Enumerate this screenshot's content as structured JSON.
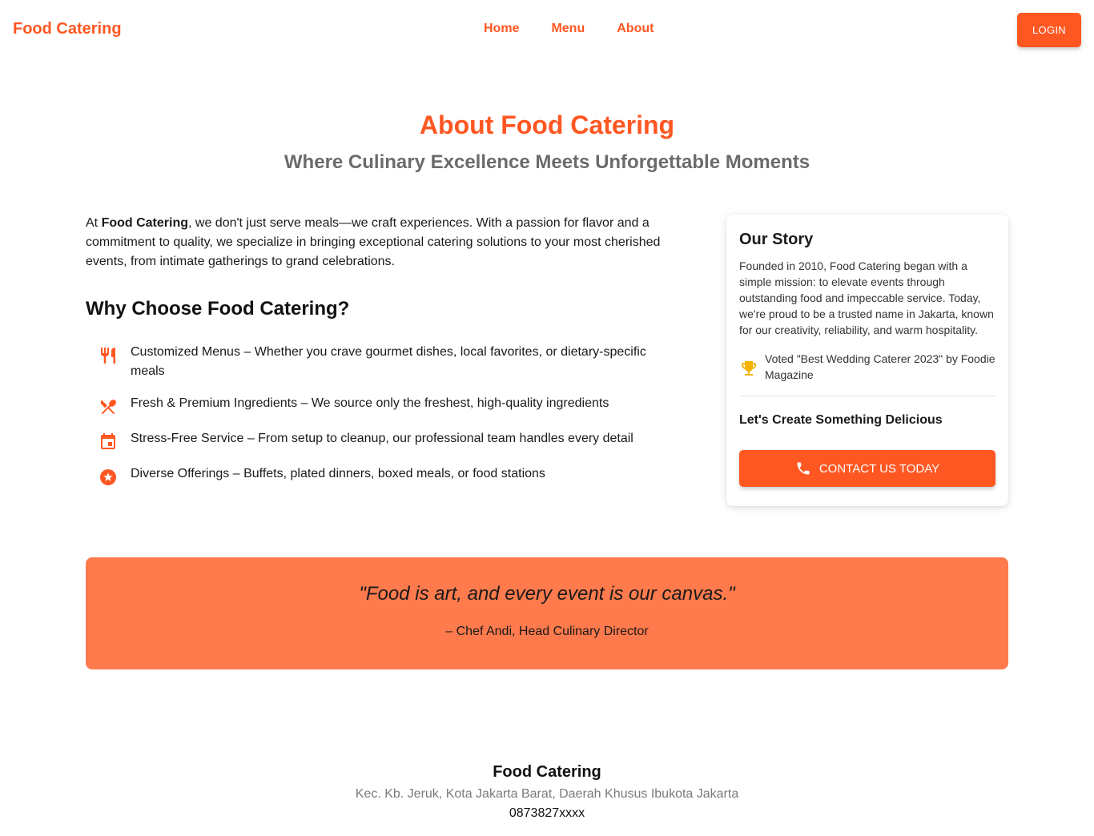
{
  "header": {
    "brand": "Food Catering",
    "nav": [
      {
        "label": "Home"
      },
      {
        "label": "Menu"
      },
      {
        "label": "About"
      }
    ],
    "login_label": "LOGIN"
  },
  "hero": {
    "title": "About Food Catering",
    "subtitle": "Where Culinary Excellence Meets Unforgettable Moments"
  },
  "intro": {
    "prefix": "At ",
    "brand": "Food Catering",
    "rest": ", we don't just serve meals—we craft experiences. With a passion for flavor and a commitment to quality, we specialize in bringing exceptional catering solutions to your most cherished events, from intimate gatherings to grand celebrations."
  },
  "why": {
    "title": "Why Choose Food Catering?",
    "items": [
      {
        "icon": "restaurant-icon",
        "text": "Customized Menus – Whether you crave gourmet dishes, local favorites, or dietary-specific meals"
      },
      {
        "icon": "dining-icon",
        "text": "Fresh & Premium Ingredients – We source only the freshest, high-quality ingredients"
      },
      {
        "icon": "event-calendar-icon",
        "text": "Stress-Free Service – From setup to cleanup, our professional team handles every detail"
      },
      {
        "icon": "star-circle-icon",
        "text": "Diverse Offerings – Buffets, plated dinners, boxed meals, or food stations"
      }
    ]
  },
  "story": {
    "title": "Our Story",
    "text": "Founded in 2010, Food Catering began with a simple mission: to elevate events through outstanding food and impeccable service. Today, we're proud to be a trusted name in Jakarta, known for our creativity, reliability, and warm hospitality.",
    "award_icon": "trophy-icon",
    "award": "Voted \"Best Wedding Caterer 2023\" by Foodie Magazine",
    "cta_title": "Let's Create Something Delicious",
    "contact_icon": "phone-icon",
    "contact_label": "CONTACT US TODAY"
  },
  "quote": {
    "text": "\"Food is art, and every event is our canvas.\"",
    "author": "– Chef Andi, Head Culinary Director"
  },
  "footer": {
    "name": "Food Catering",
    "address": "Kec. Kb. Jeruk, Kota Jakarta Barat, Daerah Khusus Ibukota Jakarta",
    "phone": "0873827xxxx"
  },
  "colors": {
    "accent": "#ff5722",
    "quote_bg": "#ff7a4c",
    "trophy": "#f5b400",
    "subtitle": "#6b6b6b"
  }
}
